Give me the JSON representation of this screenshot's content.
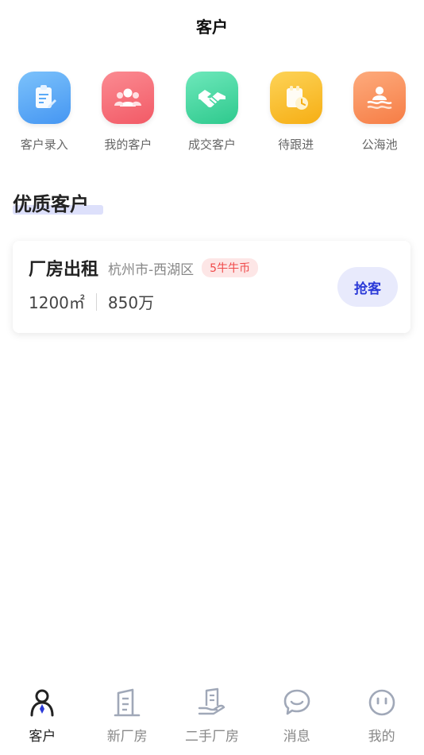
{
  "header": {
    "title": "客户"
  },
  "quick_actions": [
    {
      "label": "客户录入",
      "icon": "clipboard-edit-icon",
      "color": "#5aaaf7"
    },
    {
      "label": "我的客户",
      "icon": "users-icon",
      "color": "#f6707a"
    },
    {
      "label": "成交客户",
      "icon": "handshake-icon",
      "color": "#46d8a4"
    },
    {
      "label": "待跟进",
      "icon": "calendar-clock-icon",
      "color": "#fbc12e"
    },
    {
      "label": "公海池",
      "icon": "pool-icon",
      "color": "#fa9462"
    }
  ],
  "section": {
    "title": "优质客户"
  },
  "listing": {
    "title": "厂房出租",
    "location": "杭州市-西湖区",
    "badge": "5牛牛币",
    "area": "1200㎡",
    "price": "850万",
    "action_label": "抢客"
  },
  "tabs": [
    {
      "label": "客户",
      "icon": "customer-icon",
      "active": true
    },
    {
      "label": "新厂房",
      "icon": "building-icon",
      "active": false
    },
    {
      "label": "二手厂房",
      "icon": "hand-building-icon",
      "active": false
    },
    {
      "label": "消息",
      "icon": "message-icon",
      "active": false
    },
    {
      "label": "我的",
      "icon": "profile-face-icon",
      "active": false
    }
  ],
  "colors": {
    "accent": "#2b3ad8",
    "badge_text": "#f04a4a",
    "badge_bg": "#fde6e6",
    "tab_active": "#222222",
    "tab_inactive": "#a0a8b8"
  }
}
